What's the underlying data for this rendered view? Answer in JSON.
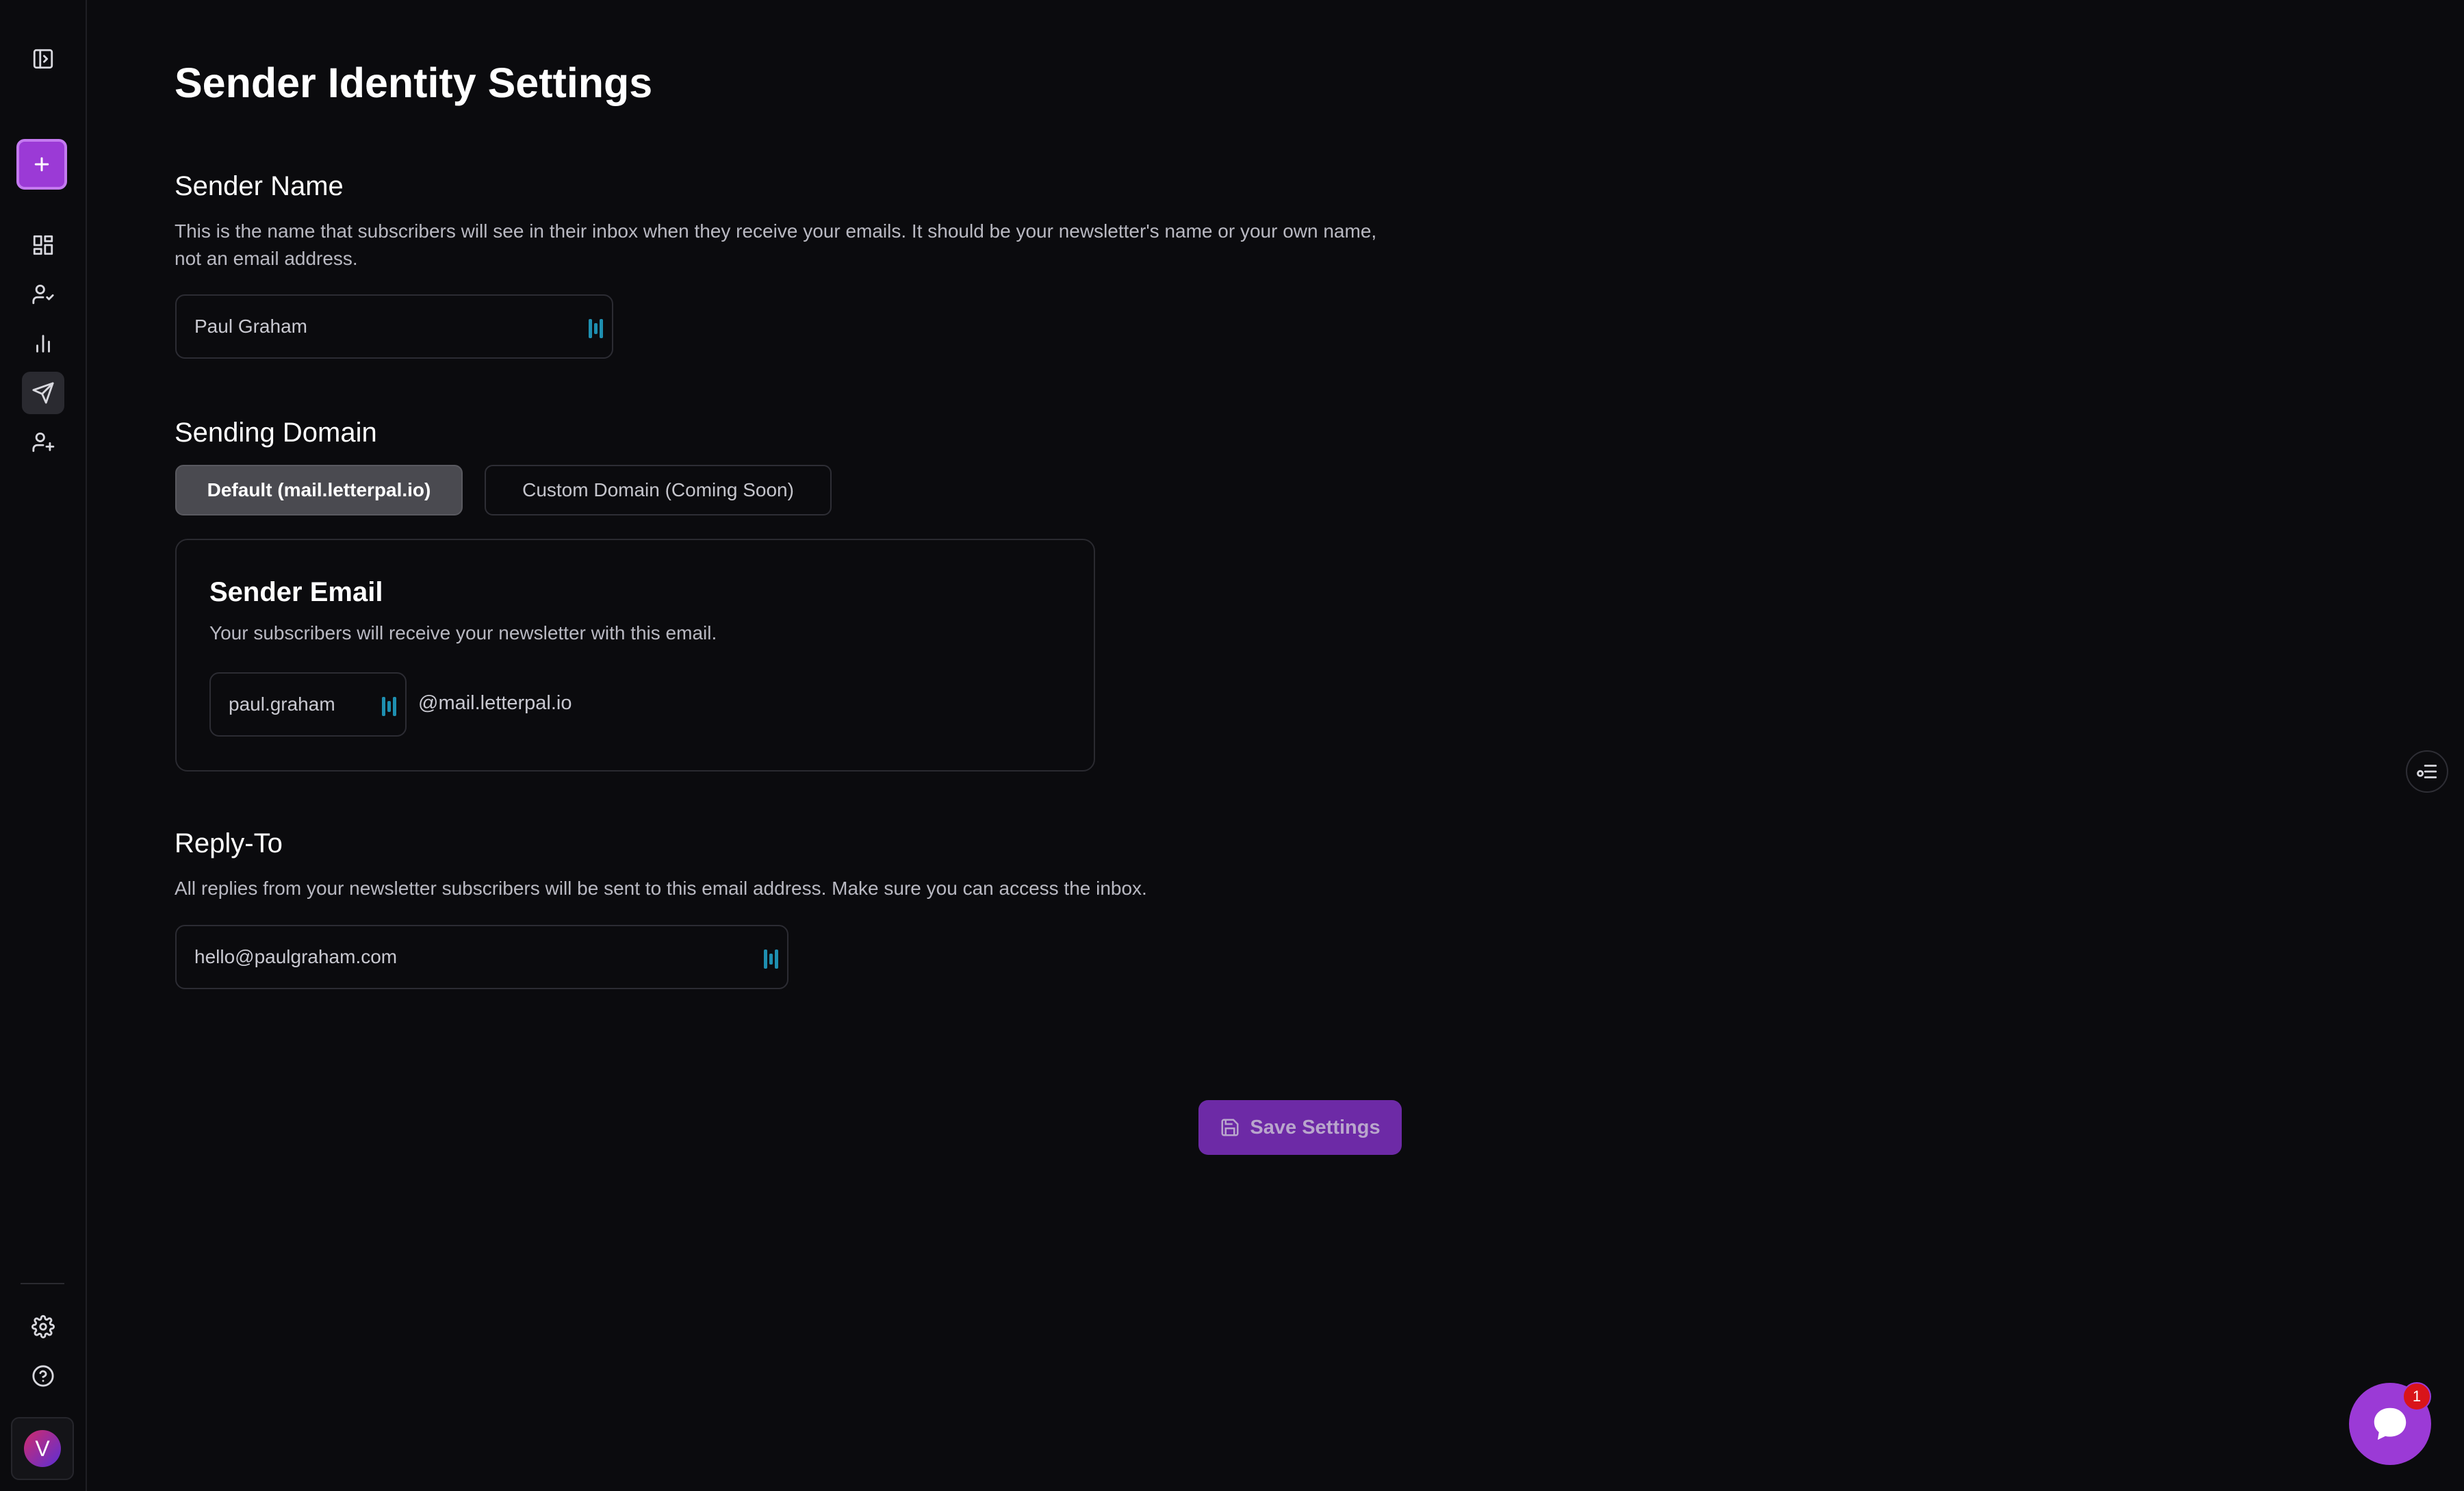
{
  "sidebar": {
    "avatar_initial": "V"
  },
  "page": {
    "title": "Sender Identity Settings"
  },
  "sender_name": {
    "title": "Sender Name",
    "description": "This is the name that subscribers will see in their inbox when they receive your emails. It should be your newsletter's name or your own name, not an email address.",
    "value": "Paul Graham"
  },
  "sending_domain": {
    "title": "Sending Domain",
    "options": [
      {
        "label": "Default (mail.letterpal.io)",
        "selected": true
      },
      {
        "label": "Custom Domain (Coming Soon)",
        "selected": false
      }
    ]
  },
  "sender_email": {
    "title": "Sender Email",
    "description": "Your subscribers will receive your newsletter with this email.",
    "local_part": "paul.graham",
    "domain_suffix": "@mail.letterpal.io"
  },
  "reply_to": {
    "title": "Reply-To",
    "description": "All replies from your newsletter subscribers will be sent to this email address. Make sure you can access the inbox.",
    "value": "hello@paulgraham.com"
  },
  "actions": {
    "save_label": "Save Settings"
  },
  "chat": {
    "badge_count": "1"
  },
  "colors": {
    "accent": "#9b3ad6",
    "background": "#0b0b0e",
    "badge": "#d9141a"
  }
}
